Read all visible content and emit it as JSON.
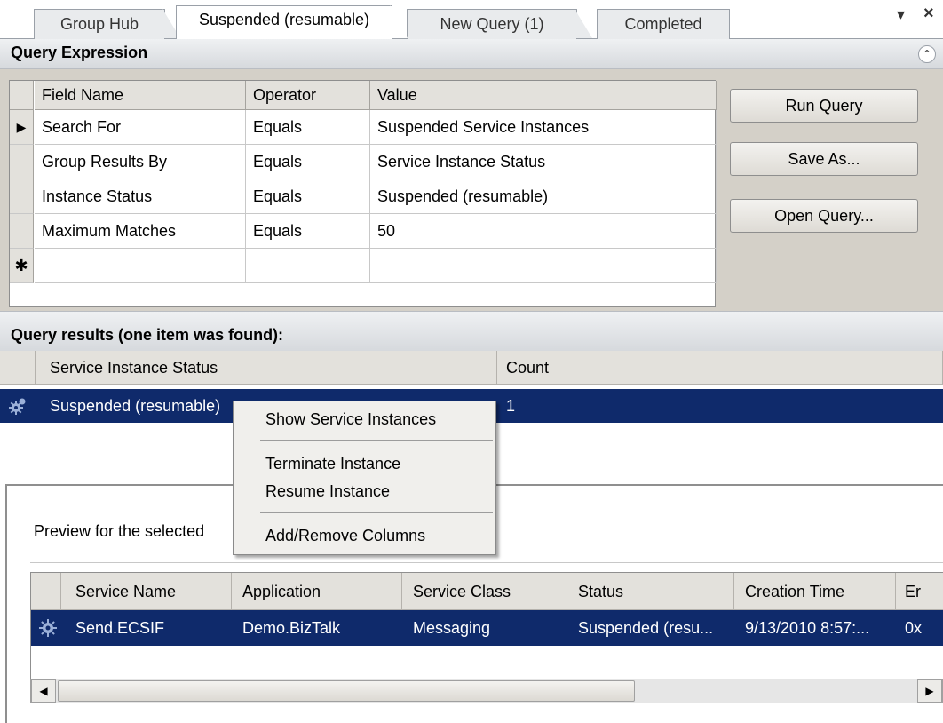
{
  "tabs": [
    {
      "label": "Group Hub",
      "active": false
    },
    {
      "label": "Suspended (resumable)",
      "active": true
    },
    {
      "label": "New Query (1)",
      "active": false
    },
    {
      "label": "Completed",
      "active": false
    }
  ],
  "window_controls": {
    "menu_glyph": "▾",
    "close_glyph": "×"
  },
  "query_expression": {
    "title": "Query Expression",
    "collapse_glyph": "⌃",
    "columns": [
      "Field Name",
      "Operator",
      "Value"
    ],
    "rows": [
      {
        "field": "Search For",
        "operator": "Equals",
        "value": "Suspended Service Instances",
        "current": true
      },
      {
        "field": "Group Results By",
        "operator": "Equals",
        "value": "Service Instance Status",
        "current": false
      },
      {
        "field": "Instance Status",
        "operator": "Equals",
        "value": "Suspended (resumable)",
        "current": false
      },
      {
        "field": "Maximum Matches",
        "operator": "Equals",
        "value": "50",
        "current": false
      }
    ],
    "current_row_glyph": "▶",
    "new_row_glyph": "✱",
    "buttons": {
      "run": "Run Query",
      "save": "Save As...",
      "open": "Open Query..."
    }
  },
  "query_results": {
    "title": "Query results (one item was found):",
    "columns": [
      "Service Instance Status",
      "Count"
    ],
    "row": {
      "status": "Suspended (resumable)",
      "count": "1",
      "icon": "gear-icon"
    }
  },
  "context_menu": {
    "items": [
      "Show Service Instances",
      "Terminate Instance",
      "Resume Instance",
      "Add/Remove Columns"
    ]
  },
  "preview": {
    "label": "Preview for the selected",
    "columns": [
      "Service Name",
      "Application",
      "Service Class",
      "Status",
      "Creation Time",
      "Er"
    ],
    "row": {
      "service_name": "Send.ECSIF",
      "application": "Demo.BizTalk",
      "service_class": "Messaging",
      "status": "Suspended (resu...",
      "creation_time": "9/13/2010 8:57:...",
      "extra": "0x",
      "icon": "gear-icon"
    }
  },
  "scrollbar": {
    "left_glyph": "◀",
    "right_glyph": "▶"
  },
  "colors": {
    "selection": "#0f2a6b",
    "panel": "#d4d0c8",
    "header": "#e3e1dc"
  }
}
